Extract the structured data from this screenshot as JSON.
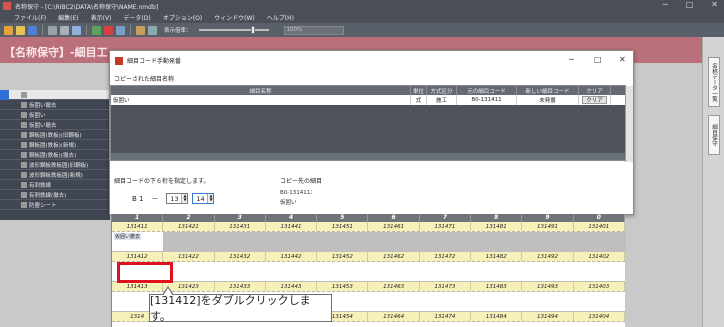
{
  "window": {
    "title": "名称保守 - [C:\\RIBC2\\DATA\\名称保守\\NAME.nmdb]",
    "min": "─",
    "max": "□",
    "close": "✕"
  },
  "menu": [
    "ファイル(F)",
    "編集(E)",
    "表示(V)",
    "データ(D)",
    "オプション(O)",
    "ウィンドウ(W)",
    "ヘルプ(H)"
  ],
  "toolbar": {
    "zoom_label": "表示倍率：",
    "zoom_value": "100%"
  },
  "header": {
    "title": "【名称保守】-細目工"
  },
  "left_list": [
    {
      "check": "",
      "label": "",
      "active": true
    },
    {
      "check": "",
      "label": "仮囲い撤去"
    },
    {
      "check": "",
      "label": "仮囲い"
    },
    {
      "check": "",
      "label": "仮囲い撤去"
    },
    {
      "check": "",
      "label": "鋼板囲(鉄板)(旧鋼板)"
    },
    {
      "check": "",
      "label": "鋼板囲(鉄板)(新規)"
    },
    {
      "check": "",
      "label": "鋼板囲(鉄板)(撤去)"
    },
    {
      "check": "",
      "label": "波形鋼板鉄板囲(旧鋼板)"
    },
    {
      "check": "",
      "label": "波形鋼板鉄板囲(新規)"
    },
    {
      "check": "",
      "label": "有刺鉄線"
    },
    {
      "check": "",
      "label": "有刺鉄線(撤去)"
    },
    {
      "check": "",
      "label": "防塵シート"
    }
  ],
  "right_panel": {
    "tab1": "名称データ一覧",
    "tab2": "細目保守"
  },
  "dialog": {
    "title": "細目コード手動発番",
    "min": "─",
    "max": "□",
    "close": "✕",
    "section_label": "コピーされた細目名称",
    "table": {
      "headers": [
        "細目名称",
        "単位",
        "方式区分",
        "元の細目コード",
        "新しい細目コード",
        "クリア"
      ],
      "rows": [
        {
          "name": "仮囲い",
          "unit": "式",
          "method": "施工",
          "orig_code": "B0-131411",
          "new_code": "未発番",
          "clear": "クリア"
        }
      ]
    },
    "instruction": "細目コードの下６桁を指定します。",
    "code_prefix": "B 1",
    "code_dash": "－",
    "spin1": "13",
    "spin2": "14",
    "dest_label": "コピー先の細目",
    "dest_code": "B0-131411：",
    "dest_name": "仮囲い"
  },
  "grid": {
    "columns": [
      "1",
      "2",
      "3",
      "4",
      "5",
      "6",
      "7",
      "8",
      "9",
      "0"
    ],
    "rows": [
      {
        "codes": [
          "131411",
          "131421",
          "131431",
          "131441",
          "131451",
          "131461",
          "131471",
          "131481",
          "131491",
          "131401"
        ],
        "tag": "仮囲い撤去"
      },
      {
        "codes": [
          "131412",
          "131422",
          "131432",
          "131442",
          "131452",
          "131462",
          "131472",
          "131482",
          "131492",
          "131402"
        ],
        "tag": ""
      },
      {
        "codes": [
          "131413",
          "131423",
          "131433",
          "131443",
          "131453",
          "131463",
          "131473",
          "131483",
          "131493",
          "131403"
        ],
        "tag": ""
      },
      {
        "codes": [
          "1314",
          "",
          "",
          "",
          "131454",
          "131464",
          "131474",
          "131484",
          "131494",
          "131404"
        ],
        "tag": ""
      }
    ]
  },
  "callout": {
    "text": "[131412]をダブルクリックします。"
  }
}
